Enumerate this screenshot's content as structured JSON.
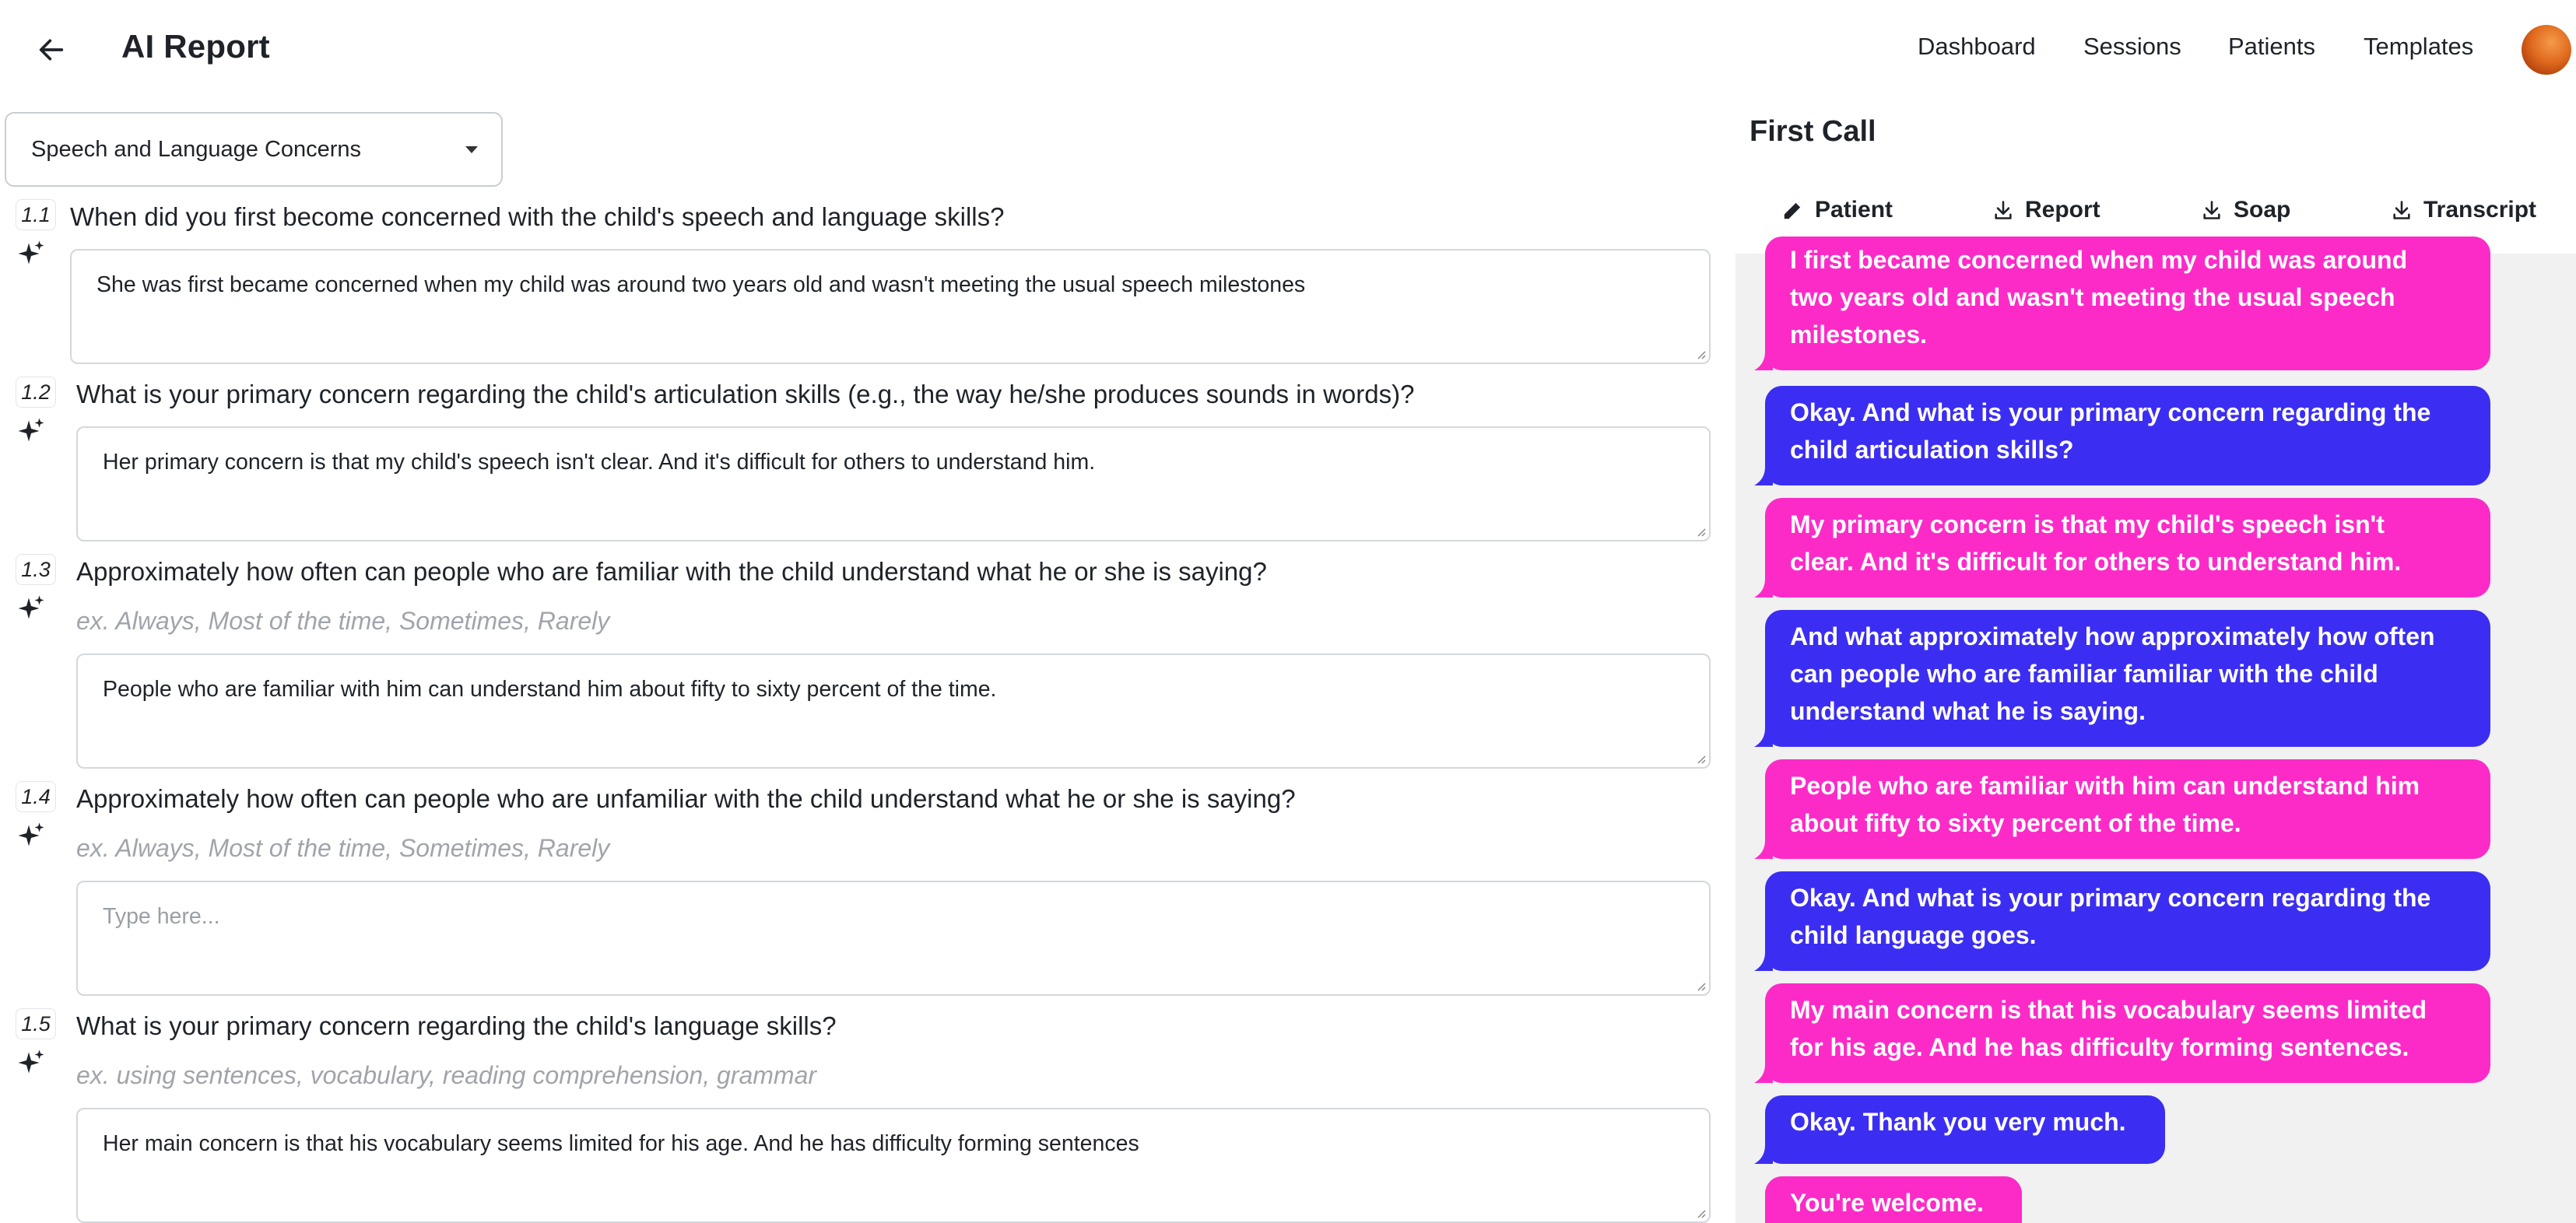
{
  "header": {
    "title": "AI Report",
    "nav": [
      "Dashboard",
      "Sessions",
      "Patients",
      "Templates"
    ]
  },
  "section_select": {
    "value": "Speech and Language Concerns"
  },
  "questions": [
    {
      "number": "1.1",
      "text": "When did you first become concerned with the child's speech and language skills?",
      "hint": "",
      "answer": "She was first became concerned when my child was around two years old and wasn't meeting the usual speech milestones",
      "placeholder": "Type here..."
    },
    {
      "number": "1.2",
      "text": "What is your primary concern regarding the child's articulation skills (e.g., the way he/she produces sounds in words)?",
      "hint": "",
      "answer": "Her primary concern is that my child's speech isn't clear. And it's difficult for others to understand him.",
      "placeholder": "Type here..."
    },
    {
      "number": "1.3",
      "text": "Approximately how often can people who are familiar with the child understand what he or she is saying?",
      "hint": "ex. Always, Most of the time, Sometimes, Rarely",
      "answer": "People who are familiar with him can understand him about fifty to sixty percent of the time.",
      "placeholder": "Type here..."
    },
    {
      "number": "1.4",
      "text": "Approximately how often can people who are unfamiliar with the child understand what he or she is saying?",
      "hint": "ex. Always, Most of the time, Sometimes, Rarely",
      "answer": "",
      "placeholder": "Type here..."
    },
    {
      "number": "1.5",
      "text": "What is your primary concern regarding the child's language skills?",
      "hint": "ex. using sentences, vocabulary, reading comprehension, grammar",
      "answer": "Her main concern is that his vocabulary seems limited for his age. And he has difficulty forming sentences",
      "placeholder": "Type here..."
    }
  ],
  "call_panel": {
    "title": "First Call",
    "actions": [
      "Patient",
      "Report",
      "Soap",
      "Transcript"
    ]
  },
  "transcript": [
    {
      "speaker": "caregiver",
      "lines": [
        "I first became concerned when my child was around",
        "two years old and wasn't meeting the usual speech",
        "milestones."
      ]
    },
    {
      "speaker": "clinician",
      "lines": [
        "Okay. And what is your primary concern regarding the",
        "child articulation skills?"
      ]
    },
    {
      "speaker": "caregiver",
      "lines": [
        "My primary concern is that my child's speech isn't",
        "clear. And it's difficult for others to understand him."
      ]
    },
    {
      "speaker": "clinician",
      "lines": [
        "And what approximately how approximately how often",
        "can people who are familiar familiar with the child",
        "understand what he is saying."
      ]
    },
    {
      "speaker": "caregiver",
      "lines": [
        "People who are familiar with him can understand him",
        "about fifty to sixty percent of the time."
      ]
    },
    {
      "speaker": "clinician",
      "lines": [
        "Okay. And what is your primary concern regarding the",
        "child language goes."
      ]
    },
    {
      "speaker": "caregiver",
      "lines": [
        "My main concern is that his vocabulary seems limited",
        "for his age. And he has difficulty forming sentences."
      ]
    },
    {
      "speaker": "clinician",
      "lines": [
        "Okay. Thank you very much."
      ]
    },
    {
      "speaker": "caregiver",
      "lines": [
        "You're welcome."
      ]
    }
  ],
  "colors": {
    "caregiver_bubble": "#fc2bc8",
    "clinician_bubble": "#3b2ef2",
    "panel_background": "#f1f1f1",
    "hint_text": "#a1a4aa"
  },
  "icons": {
    "back": "arrow-left-icon",
    "sparkle": "sparkle-icon",
    "patient": "pencil-icon",
    "download": "download-icon"
  }
}
